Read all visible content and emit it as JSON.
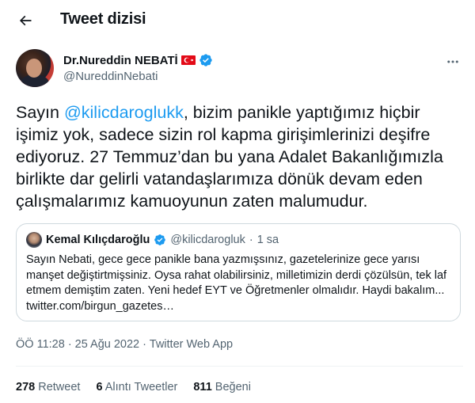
{
  "header": {
    "title": "Tweet dizisi",
    "back_icon": "arrow-left-icon"
  },
  "author": {
    "name": "Dr.Nureddin NEBATİ",
    "handle": "@NureddinNebati",
    "flag_icon": "turkey-flag-icon",
    "verified_icon": "verified-badge-icon",
    "verified_color": "#1d9bf0"
  },
  "tweet": {
    "text_before": "Sayın ",
    "mention": "@kilicdaroglukk",
    "text_after": ", bizim panikle yaptığımız hiçbir işimiz yok, sadece sizin rol kapma girişimlerinizi deşifre ediyoruz. 27 Temmuz’dan bu yana Adalet Bakanlığımızla birlikte dar gelirli vatandaşlarımıza dönük devam eden çalışmalarımız kamuoyunun zaten malumudur."
  },
  "quote": {
    "name": "Kemal Kılıçdaroğlu",
    "handle": "@kilicdarogluk",
    "dot": "·",
    "time": "1 sa",
    "text": "Sayın Nebati, gece gece panikle bana yazmışsınız, gazetelerinize gece yarısı manşet değiştirtmişsiniz. Oysa rahat olabilirsiniz, milletimizin derdi çözülsün, tek laf etmem demiştim zaten. Yeni hedef EYT ve Öğretmenler olmalıdır. Haydi bakalım... twitter.com/birgun_gazetes…"
  },
  "meta": {
    "timestamp": "ÖÖ 11:28 · 25 Ağu 2022 ·",
    "app": "Twitter Web App"
  },
  "stats": {
    "retweets_count": "278",
    "retweets_label": "Retweet",
    "quotes_count": "6",
    "quotes_label": "Alıntı Tweetler",
    "likes_count": "811",
    "likes_label": "Beğeni"
  },
  "colors": {
    "accent": "#1d9bf0",
    "text": "#0f1419",
    "secondary": "#536471",
    "border": "#cfd9de"
  }
}
